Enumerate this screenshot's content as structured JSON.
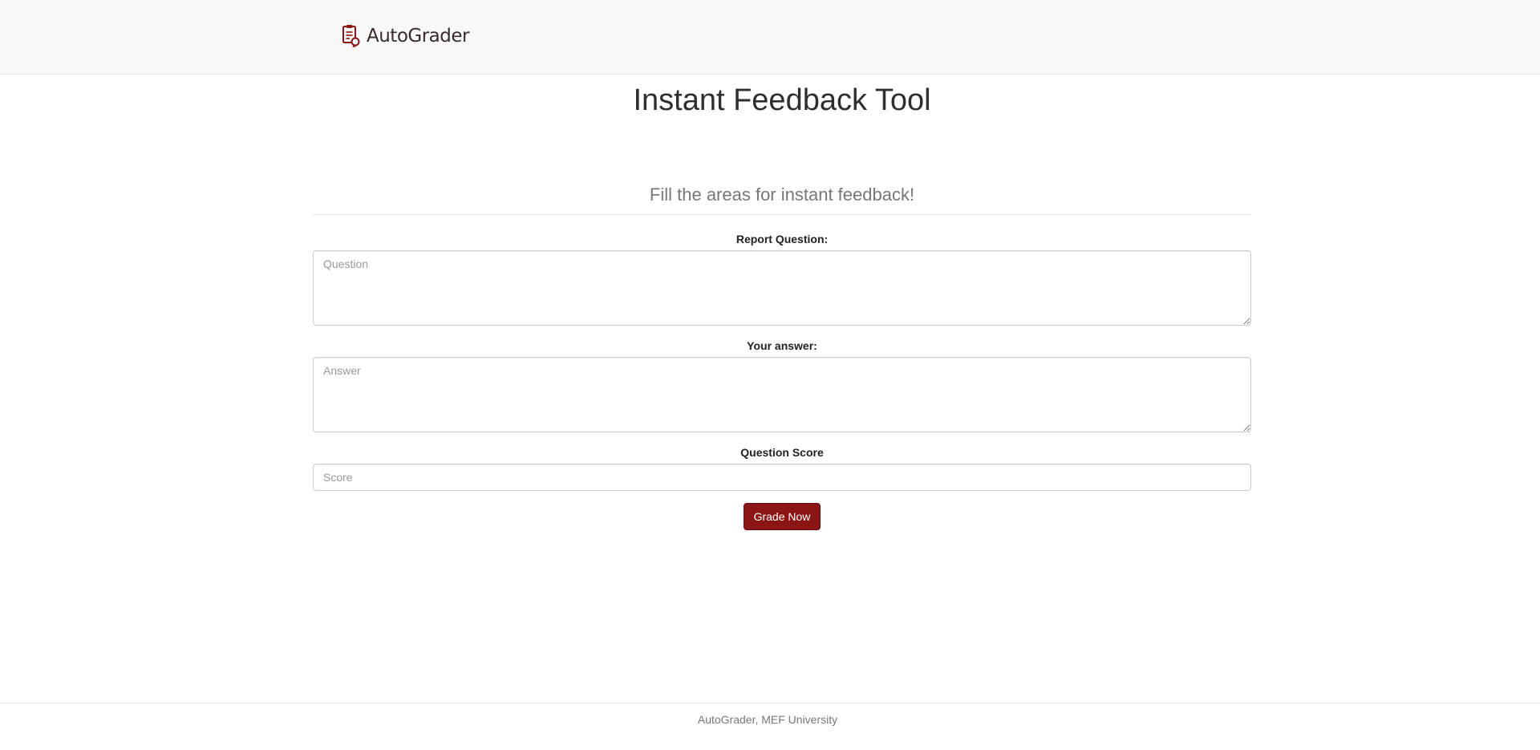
{
  "navbar": {
    "brand_name": "AutoGrader",
    "brand_icon": "certificate-document-icon"
  },
  "main": {
    "title": "Instant Feedback Tool",
    "subtitle": "Fill the areas for instant feedback!"
  },
  "form": {
    "question_label": "Report Question:",
    "question_placeholder": "Question",
    "question_value": "",
    "answer_label": "Your answer:",
    "answer_placeholder": "Answer",
    "answer_value": "",
    "score_label": "Question Score",
    "score_placeholder": "Score",
    "score_value": "",
    "submit_label": "Grade Now"
  },
  "footer": {
    "text": "AutoGrader, MEF University"
  },
  "colors": {
    "brand": "#8b1414",
    "navbar_bg": "#f8f8f8"
  }
}
